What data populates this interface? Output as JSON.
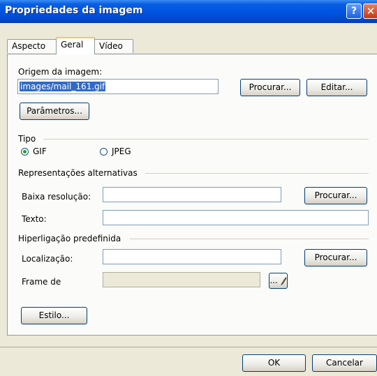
{
  "window": {
    "title": "Propriedades da imagem",
    "help_glyph": "?",
    "close_glyph": "✕"
  },
  "tabs": [
    {
      "label": "Aspecto"
    },
    {
      "label": "Geral"
    },
    {
      "label": "Vídeo"
    }
  ],
  "origem": {
    "label": "Origem da imagem:",
    "value": "images/mail_161.gif",
    "browse_label": "Procurar...",
    "edit_label": "Editar...",
    "params_label": "Parâmetros..."
  },
  "tipo": {
    "group_label": "Tipo",
    "options": [
      {
        "label": "GIF",
        "checked": true
      },
      {
        "label": "JPEG",
        "checked": false
      }
    ]
  },
  "alternativas": {
    "group_label": "Representações alternativas",
    "low_res_label": "Baixa resolução:",
    "low_res_value": "",
    "browse_label": "Procurar...",
    "text_label": "Texto:",
    "text_value": ""
  },
  "hiperligacao": {
    "group_label": "Hiperligação predefinida",
    "location_label": "Localização:",
    "location_value": "",
    "browse_label": "Procurar...",
    "frame_label": "Frame de",
    "frame_value": "",
    "frame_button_label": "..."
  },
  "style_button_label": "Estilo...",
  "footer": {
    "ok_label": "OK",
    "cancel_label": "Cancelar"
  }
}
